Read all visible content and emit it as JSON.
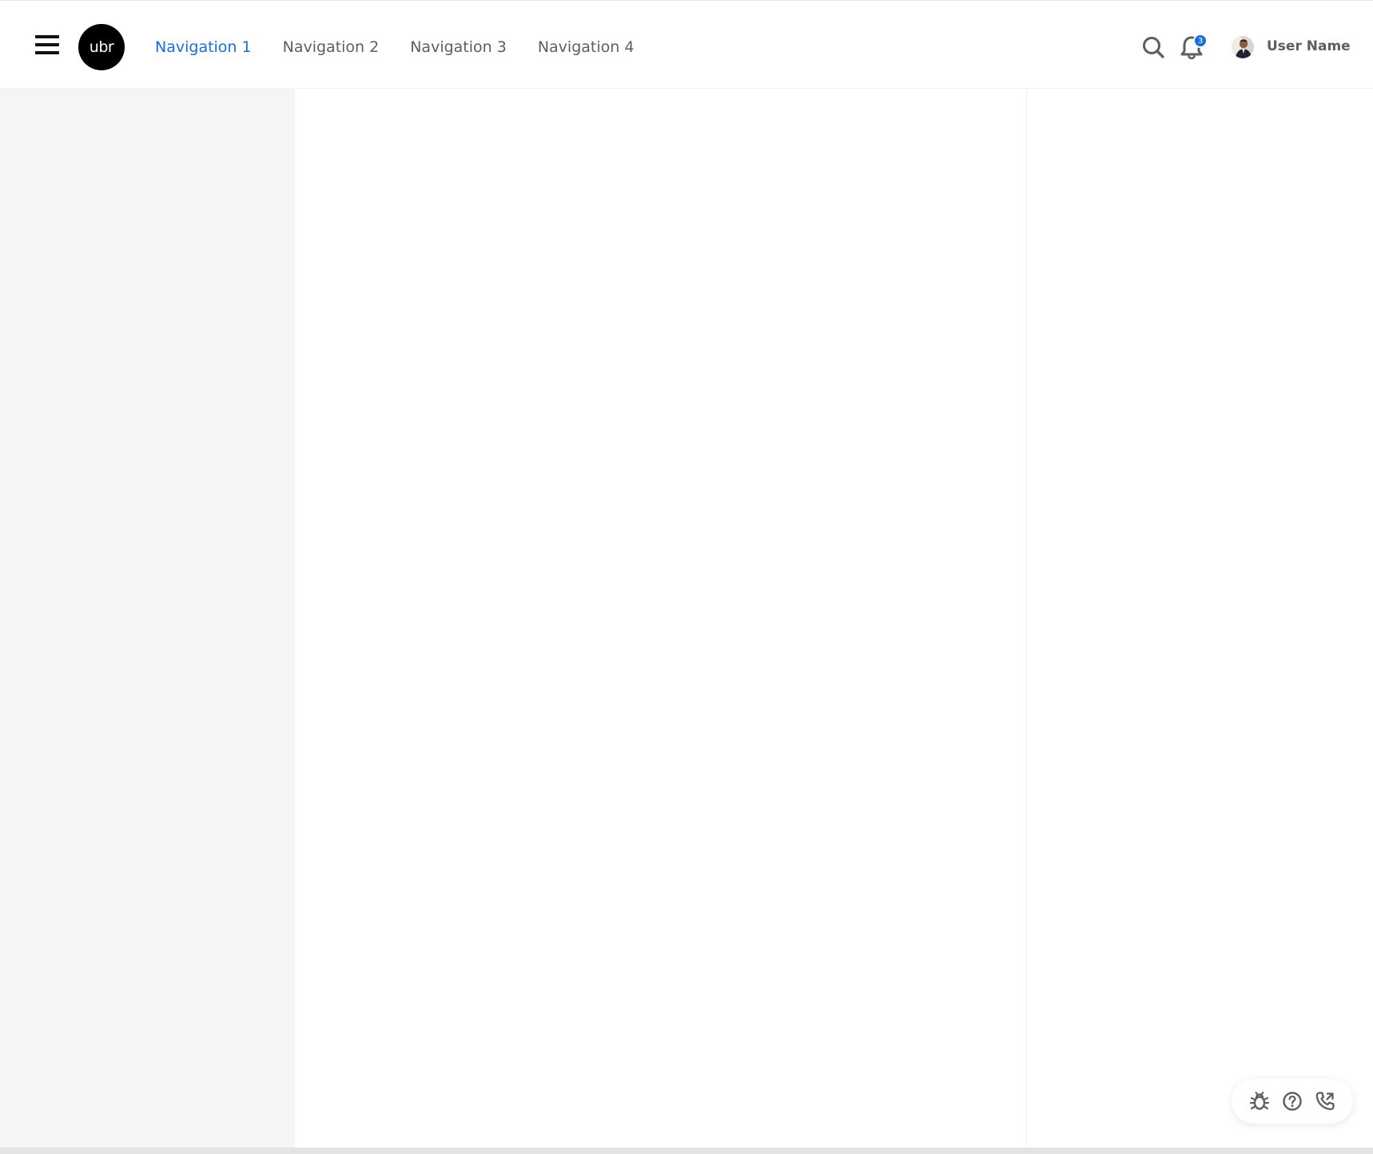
{
  "header": {
    "menu_icon": "hamburger-icon",
    "logo_text": "ubr",
    "nav": [
      {
        "label": "Navigation 1",
        "active": true
      },
      {
        "label": "Navigation 2",
        "active": false
      },
      {
        "label": "Navigation 3",
        "active": false
      },
      {
        "label": "Navigation 4",
        "active": false
      }
    ],
    "search_icon": "search-icon",
    "notifications": {
      "icon": "bell-icon",
      "count": "3"
    },
    "user": {
      "name": "User Name",
      "avatar_icon": "avatar-photo"
    }
  },
  "floating_actions": [
    {
      "icon": "bug-icon"
    },
    {
      "icon": "help-circle-icon"
    },
    {
      "icon": "phone-icon"
    }
  ],
  "colors": {
    "accent": "#1a6ed8",
    "nav_text": "#5e5e5e",
    "sidebar_bg": "#f5f5f5",
    "logo_bg": "#000000"
  }
}
